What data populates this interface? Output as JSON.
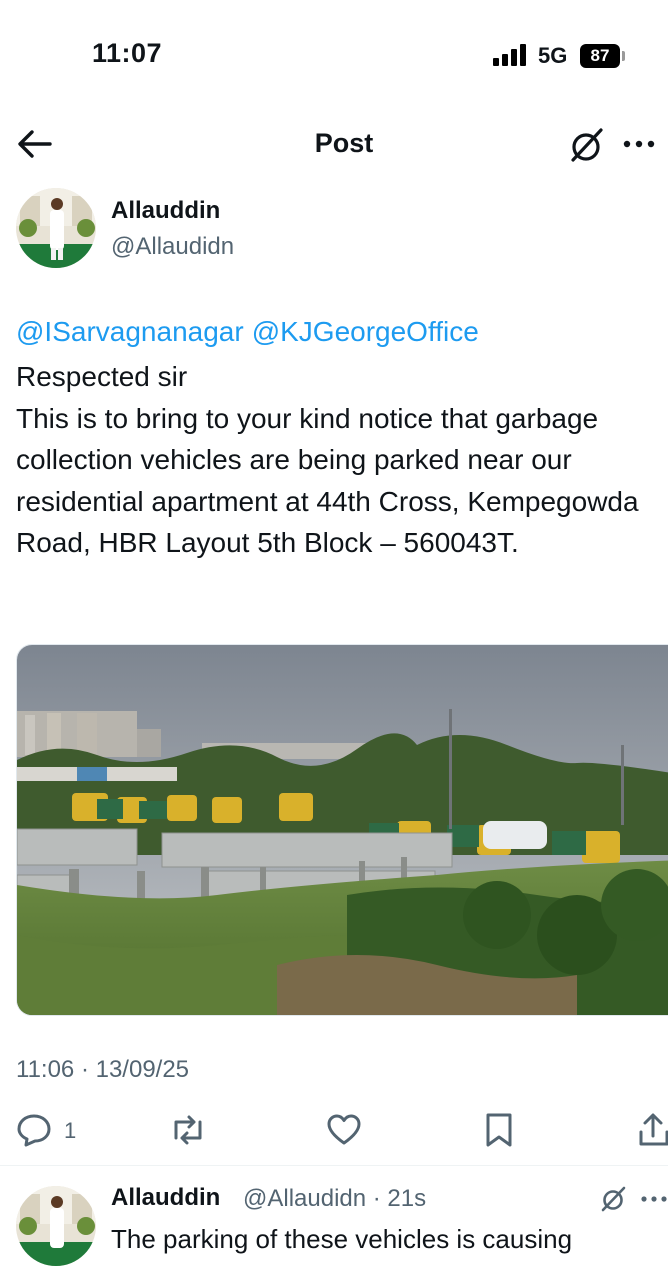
{
  "status_bar": {
    "time": "11:07",
    "network": "5G",
    "battery": "87"
  },
  "header": {
    "title": "Post"
  },
  "post": {
    "author": {
      "name": "Allauddin",
      "handle": "@Allaudidn"
    },
    "mentions": [
      "@ISarvagnanagar",
      "@KJGeorgeOffice"
    ],
    "text": "Respected sir\nThis is to bring to your kind notice that garbage collection vehicles are being parked near our residential apartment at 44th Cross, Kempegowda Road, HBR Layout 5th Block – 560043T.",
    "timestamp": "11:06 · 13/09/25",
    "reply_count": "1"
  },
  "reply": {
    "name": "Allauddin",
    "handle_time": "@Allaudidn · 21s",
    "text": "The parking of these vehicles is causing"
  },
  "colors": {
    "link": "#1d9bf0",
    "secondary": "#536471",
    "text": "#0f1419"
  },
  "icons": [
    "back-arrow-icon",
    "grok-icon",
    "more-icon",
    "reply-icon",
    "repost-icon",
    "like-icon",
    "bookmark-icon",
    "share-icon"
  ]
}
